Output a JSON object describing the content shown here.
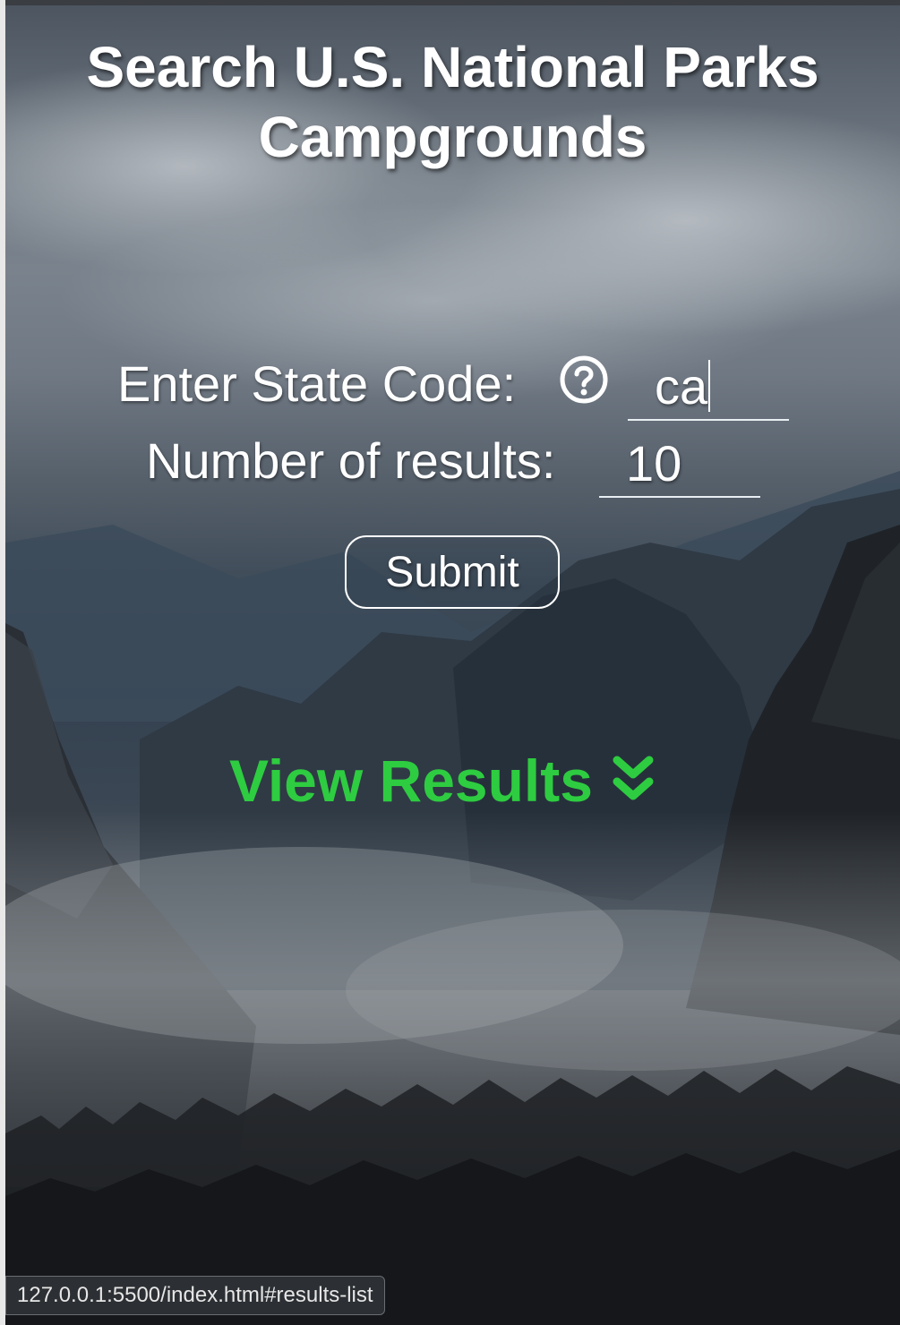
{
  "page": {
    "title_line1": "Search U.S. National Parks",
    "title_line2": "Campgrounds"
  },
  "form": {
    "state_label": "Enter State Code:",
    "state_value": "ca",
    "results_label": "Number of results:",
    "results_value": "10",
    "submit_label": "Submit"
  },
  "view_results": {
    "label": "View Results",
    "icon": "double-chevron-down-icon",
    "color": "#2ecc40"
  },
  "help": {
    "icon": "question-circle-icon"
  },
  "status_bar": {
    "url": "127.0.0.1:5500/index.html#results-list"
  }
}
